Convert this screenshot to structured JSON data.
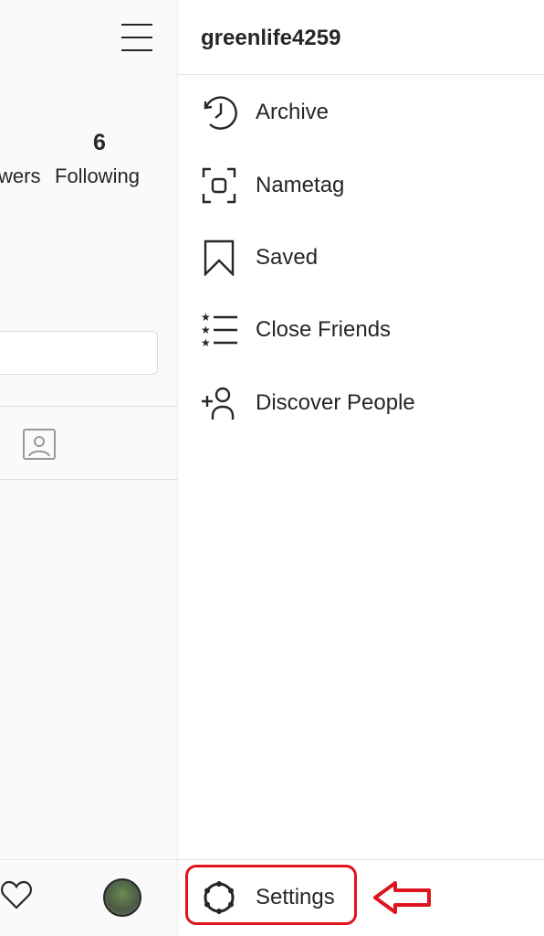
{
  "profile": {
    "following_count": "6",
    "following_label": "Following",
    "followers_label_partial": "wers"
  },
  "drawer": {
    "username": "greenlife4259",
    "items": [
      {
        "label": "Archive",
        "icon": "archive-clock-icon"
      },
      {
        "label": "Nametag",
        "icon": "nametag-icon"
      },
      {
        "label": "Saved",
        "icon": "bookmark-icon"
      },
      {
        "label": "Close Friends",
        "icon": "close-friends-list-icon"
      },
      {
        "label": "Discover People",
        "icon": "add-person-icon"
      }
    ],
    "settings_label": "Settings"
  },
  "annotation": {
    "highlight_color": "#e0141e"
  }
}
